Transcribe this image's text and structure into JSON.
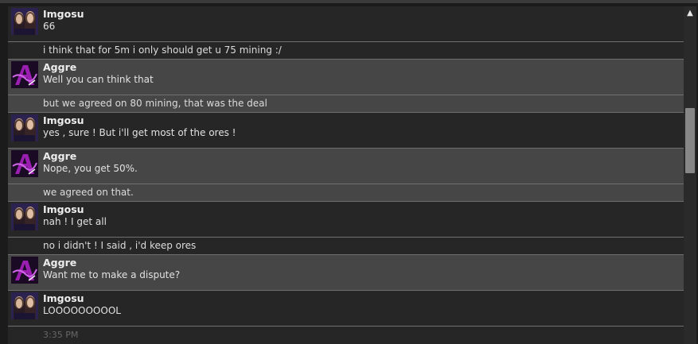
{
  "messages": [
    {
      "author": "Imgosu",
      "avatar": "imgosu",
      "style": "base",
      "lines": [
        "66",
        "i think that for 5m i only should get u 75 mining :/"
      ]
    },
    {
      "author": "Aggre",
      "avatar": "aggre",
      "style": "alt",
      "lines": [
        "Well you can think that",
        "but we agreed on 80 mining, that was the deal"
      ]
    },
    {
      "author": "Imgosu",
      "avatar": "imgosu",
      "style": "base",
      "lines": [
        "yes , sure ! But i'll get most of the ores !"
      ]
    },
    {
      "author": "Aggre",
      "avatar": "aggre",
      "style": "alt",
      "lines": [
        "Nope, you get 50%.",
        "we agreed on that."
      ]
    },
    {
      "author": "Imgosu",
      "avatar": "imgosu",
      "style": "base",
      "lines": [
        "nah ! I get all",
        "no i didn't ! I said , i'd keep ores"
      ]
    },
    {
      "author": "Aggre",
      "avatar": "aggre",
      "style": "alt",
      "lines": [
        "Want me to make a dispute?"
      ]
    },
    {
      "author": "Imgosu",
      "avatar": "imgosu",
      "style": "base",
      "lines": [
        "LOOOOOOOOOL"
      ],
      "time": "3:35 PM"
    }
  ],
  "colors": {
    "alt_bg": "#464646",
    "base_bg": "#262626",
    "imgosu_avatar": "#2b2250",
    "aggre_avatar": "#9a1fb0"
  },
  "icons": {
    "scroll_up": "▲"
  }
}
